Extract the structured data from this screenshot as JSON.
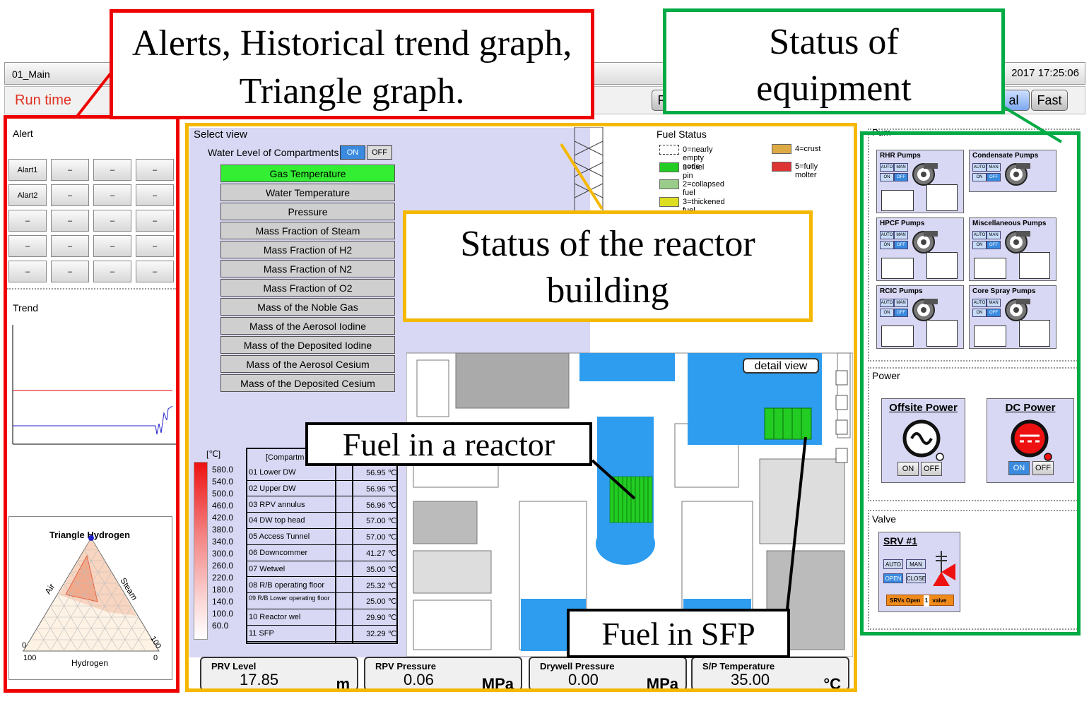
{
  "window": {
    "title": "01_Main",
    "datetime": "2017 17:25:06"
  },
  "toolbar": {
    "run_time": "Run time",
    "btn_r": "R",
    "btn_normal": "al",
    "btn_fast": "Fast"
  },
  "callouts": {
    "left": "Alerts, Historical trend graph, Triangle graph.",
    "right": "Status of equipment",
    "reactor": "Status of the reactor building",
    "fuel_reactor": "Fuel in a reactor",
    "fuel_sfp": "Fuel in SFP"
  },
  "alert": {
    "title": "Alert",
    "cells": [
      [
        "Alart1",
        "–",
        "–",
        "–"
      ],
      [
        "Alart2",
        "–",
        "–",
        "–"
      ],
      [
        "–",
        "–",
        "–",
        "–"
      ],
      [
        "–",
        "–",
        "–",
        "–"
      ],
      [
        "–",
        "–",
        "–",
        "–"
      ]
    ]
  },
  "trend": {
    "title": "Trend"
  },
  "triangle": {
    "title": "Triangle Hydrogen",
    "air": "Air",
    "steam": "Steam",
    "hydrogen": "Hydrogen",
    "l0": "0",
    "l100a": "100",
    "r100": "100",
    "r0": "0"
  },
  "view": {
    "title": "Select view",
    "water_level_label": "Water Level of Compartments",
    "on": "ON",
    "off": "OFF",
    "items": [
      "Gas Temperature",
      "Water Temperature",
      "Pressure",
      "Mass Fraction of Steam",
      "Mass Fraction of H2",
      "Mass Fraction of N2",
      "Mass Fraction of O2",
      "Mass of the Noble Gas",
      "Mass of the Aerosol Iodine",
      "Mass of the Deposited Iodine",
      "Mass of the Aerosol Cesium",
      "Mass of the Deposited Cesium"
    ]
  },
  "scale": {
    "unit": "[℃]",
    "ticks": [
      "580.0",
      "540.0",
      "500.0",
      "460.0",
      "420.0",
      "380.0",
      "340.0",
      "300.0",
      "260.0",
      "220.0",
      "180.0",
      "140.0",
      "100.0",
      "60.0"
    ]
  },
  "compartments": {
    "header": "[Compartm",
    "rows": [
      {
        "name": "01 Lower DW",
        "value": "56.95 ℃"
      },
      {
        "name": "02 Upper DW",
        "value": "56.96 ℃"
      },
      {
        "name": "03 RPV annulus",
        "value": "56.96 ℃"
      },
      {
        "name": "04 DW top head",
        "value": "57.00 ℃"
      },
      {
        "name": "05 Access Tunnel",
        "value": "57.00 ℃"
      },
      {
        "name": "06 Downcommer",
        "value": "41.27 ℃"
      },
      {
        "name": "07 Wetwel",
        "value": "35.00 ℃"
      },
      {
        "name": "08 R/B operating floor",
        "value": "25.32 ℃"
      },
      {
        "name": "09 R/B Lower operating floor",
        "value": "25.00 ℃"
      },
      {
        "name": "10 Reactor wel",
        "value": "29.90 ℃"
      },
      {
        "name": "11 SFP",
        "value": "32.29 ℃"
      }
    ]
  },
  "fuel_status": {
    "title": "Fuel Status",
    "items": [
      {
        "label": "0=nearly empty node",
        "color": "#ffffff"
      },
      {
        "label": "1=fuel pin",
        "color": "#22cc22"
      },
      {
        "label": "2=collapsed fuel",
        "color": "#99cc88"
      },
      {
        "label": "3=thickened fuel",
        "color": "#dddd22"
      },
      {
        "label": "4=crust",
        "color": "#ddaa44"
      },
      {
        "label": "5=fully molter",
        "color": "#dd3333"
      }
    ]
  },
  "detail_view": "detail view",
  "gauges": [
    {
      "title": "PRV Level",
      "value": "17.85",
      "unit": "m"
    },
    {
      "title": "RPV Pressure",
      "value": "0.06",
      "unit": "MPa"
    },
    {
      "title": "Drywell Pressure",
      "value": "0.00",
      "unit": "MPa"
    },
    {
      "title": "S/P Temperature",
      "value": "35.00",
      "unit": "°C"
    }
  ],
  "pumps": {
    "title": "Pum",
    "items": [
      "RHR Pumps",
      "Condensate Pumps",
      "HPCF Pumps",
      "Miscellaneous Pumps",
      "RCIC Pumps",
      "Core Spray Pumps"
    ],
    "auto": "AUTO",
    "man": "MAN",
    "on": "ON",
    "off": "OFF"
  },
  "power": {
    "title": "Power",
    "offsite": "Offsite Power",
    "dc": "DC Power",
    "on": "ON",
    "off": "OFF"
  },
  "valve": {
    "title": "Valve",
    "srv": "SRV #1",
    "auto": "AUTO",
    "man": "MAN",
    "open": "OPEN",
    "close": "CLOSE",
    "status_pre": "SRVs Open",
    "count": "1",
    "status_post": "valve"
  },
  "colors": {
    "alert_box": "#ee0000",
    "reactor_box": "#f5b800",
    "equipment_box": "#00aa44",
    "water": "#2e9df0",
    "fuel": "#22cc22"
  }
}
